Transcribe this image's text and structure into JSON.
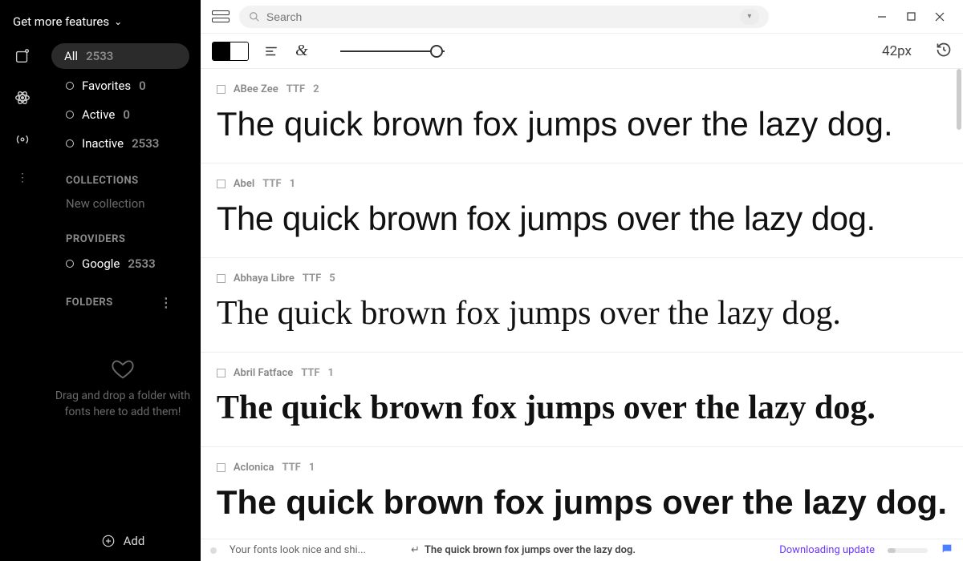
{
  "header": {
    "more_features": "Get more features"
  },
  "sidebar": {
    "all_label": "All",
    "all_count": "2533",
    "favorites_label": "Favorites",
    "favorites_count": "0",
    "active_label": "Active",
    "active_count": "0",
    "inactive_label": "Inactive",
    "inactive_count": "2533",
    "collections_header": "COLLECTIONS",
    "new_collection": "New collection",
    "providers_header": "PROVIDERS",
    "provider_google": "Google",
    "provider_google_count": "2533",
    "folders_header": "FOLDERS",
    "drop_hint": "Drag and drop a folder with fonts here to add them!",
    "add_label": "Add"
  },
  "search": {
    "placeholder": "Search"
  },
  "toolbar": {
    "size_label": "42px"
  },
  "fonts": [
    {
      "name": "ABee Zee",
      "format": "TTF",
      "count": "2",
      "sample": "The quick brown fox jumps over the lazy dog.",
      "font_css": "font-family: 'Trebuchet MS', sans-serif;"
    },
    {
      "name": "Abel",
      "format": "TTF",
      "count": "1",
      "sample": "The quick brown fox jumps over the lazy dog.",
      "font_css": "font-family: 'Segoe UI', Arial, sans-serif; font-weight:300; font-stretch: condensed; letter-spacing:-0.5px;"
    },
    {
      "name": "Abhaya Libre",
      "format": "TTF",
      "count": "5",
      "sample": "The quick brown fox jumps over the lazy dog.",
      "font_css": "font-family: Georgia, 'Times New Roman', serif;"
    },
    {
      "name": "Abril Fatface",
      "format": "TTF",
      "count": "1",
      "sample": "The quick brown fox jumps over the lazy dog.",
      "font_css": "font-family: 'Bodoni MT', Didot, Georgia, serif; font-weight:900;"
    },
    {
      "name": "Aclonica",
      "format": "TTF",
      "count": "1",
      "sample": "The quick brown fox jumps over the lazy dog.",
      "font_css": "font-family: Verdana, sans-serif; font-weight:700;"
    }
  ],
  "status": {
    "left": "Your fonts look nice and shi...",
    "preview": "The quick brown fox jumps over the lazy dog.",
    "update": "Downloading update"
  }
}
